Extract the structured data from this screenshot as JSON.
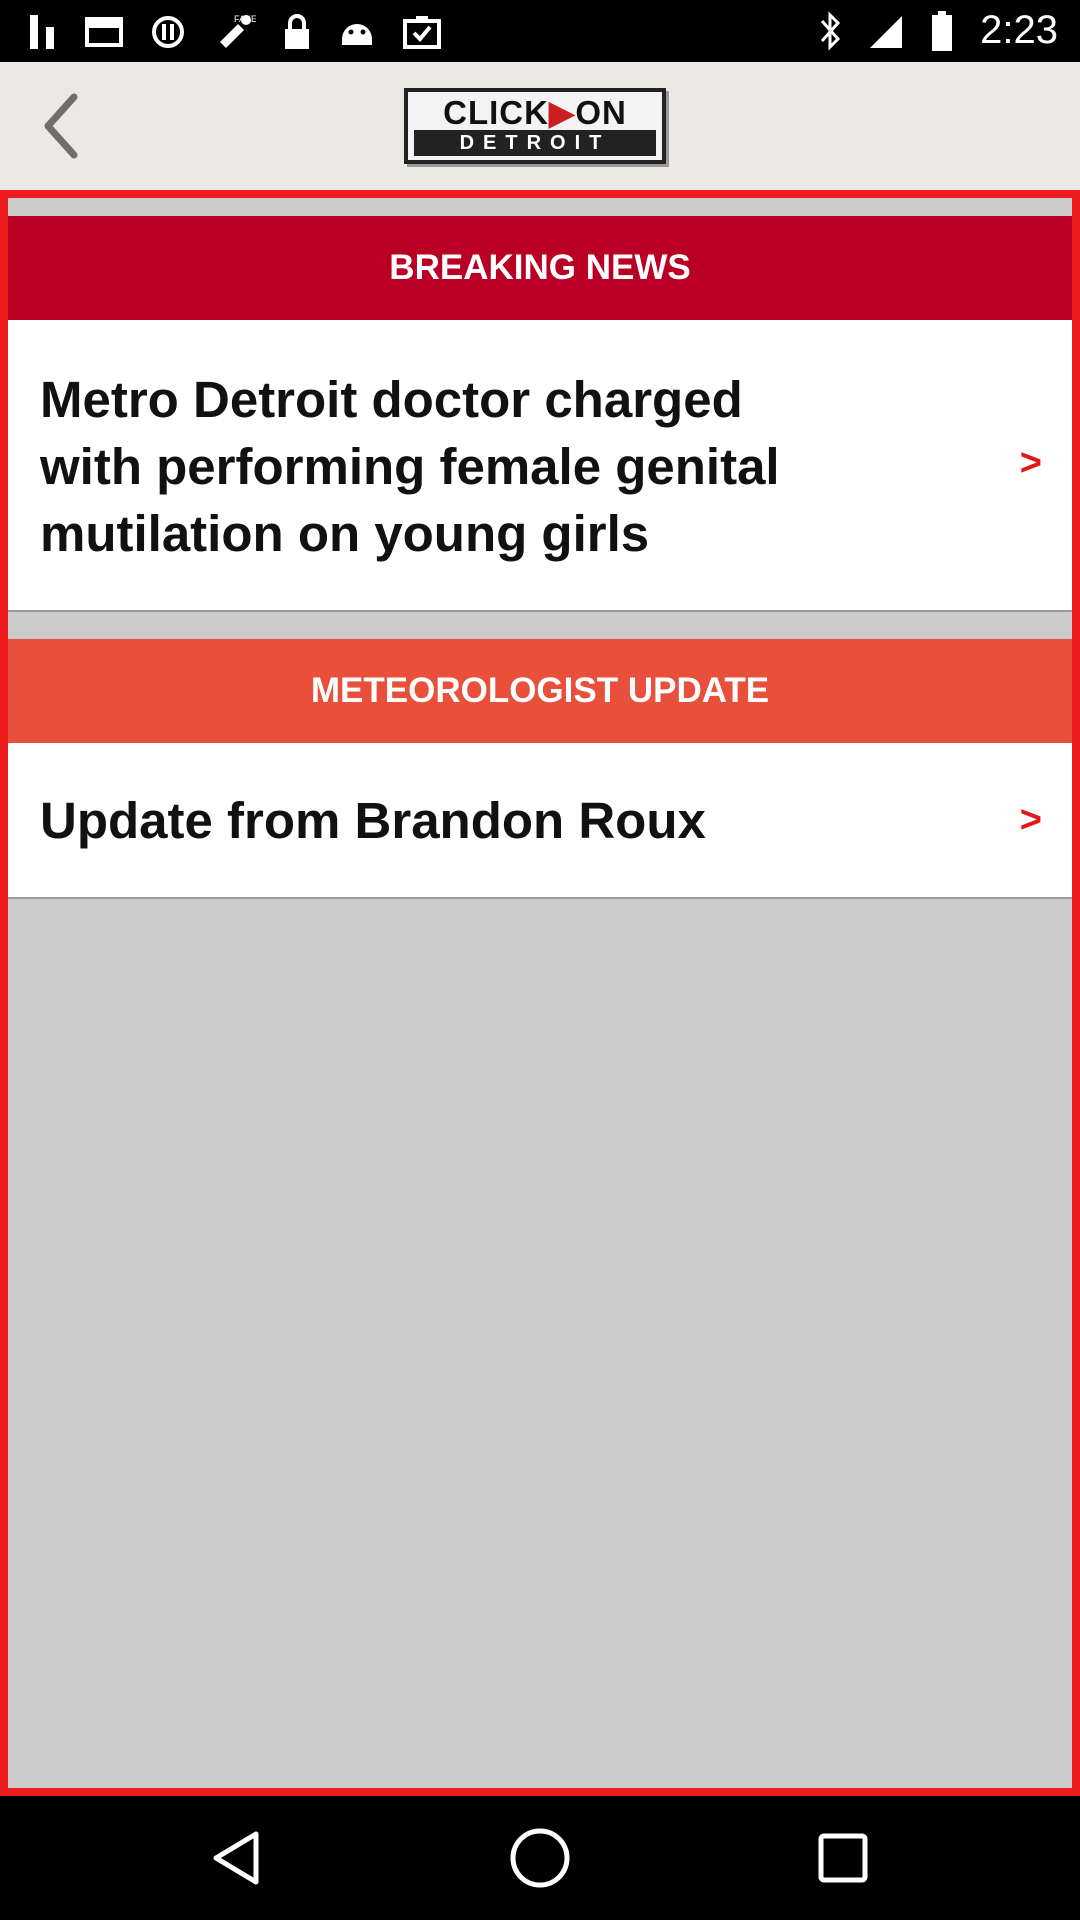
{
  "status_bar": {
    "time": "2:23",
    "icons": [
      "notification-download-icon",
      "mail-icon",
      "data-saver-icon",
      "fake-gps-icon",
      "lock-icon",
      "android-icon",
      "clipboard-check-icon",
      "bluetooth-icon",
      "signal-icon",
      "battery-icon"
    ]
  },
  "app_bar": {
    "back_icon": "chevron-left-icon",
    "logo_top_left": "CLICK",
    "logo_top_mark": "▶",
    "logo_top_right": "ON",
    "logo_bottom": "DETROIT"
  },
  "sections": [
    {
      "header": "BREAKING NEWS",
      "header_color": "#b90024",
      "story": "Metro Detroit doctor charged with performing female genital mutilation on young girls",
      "chevron": ">"
    },
    {
      "header": "METEOROLOGIST UPDATE",
      "header_color": "#e8503b",
      "story": "Update from Brandon Roux",
      "chevron": ">"
    }
  ],
  "colors": {
    "frame": "#ee1c1c",
    "chevron": "#e01a1a",
    "background": "#cbcbcb"
  },
  "nav_bar": {
    "icons": [
      "back-triangle-icon",
      "home-circle-icon",
      "recents-square-icon"
    ]
  }
}
